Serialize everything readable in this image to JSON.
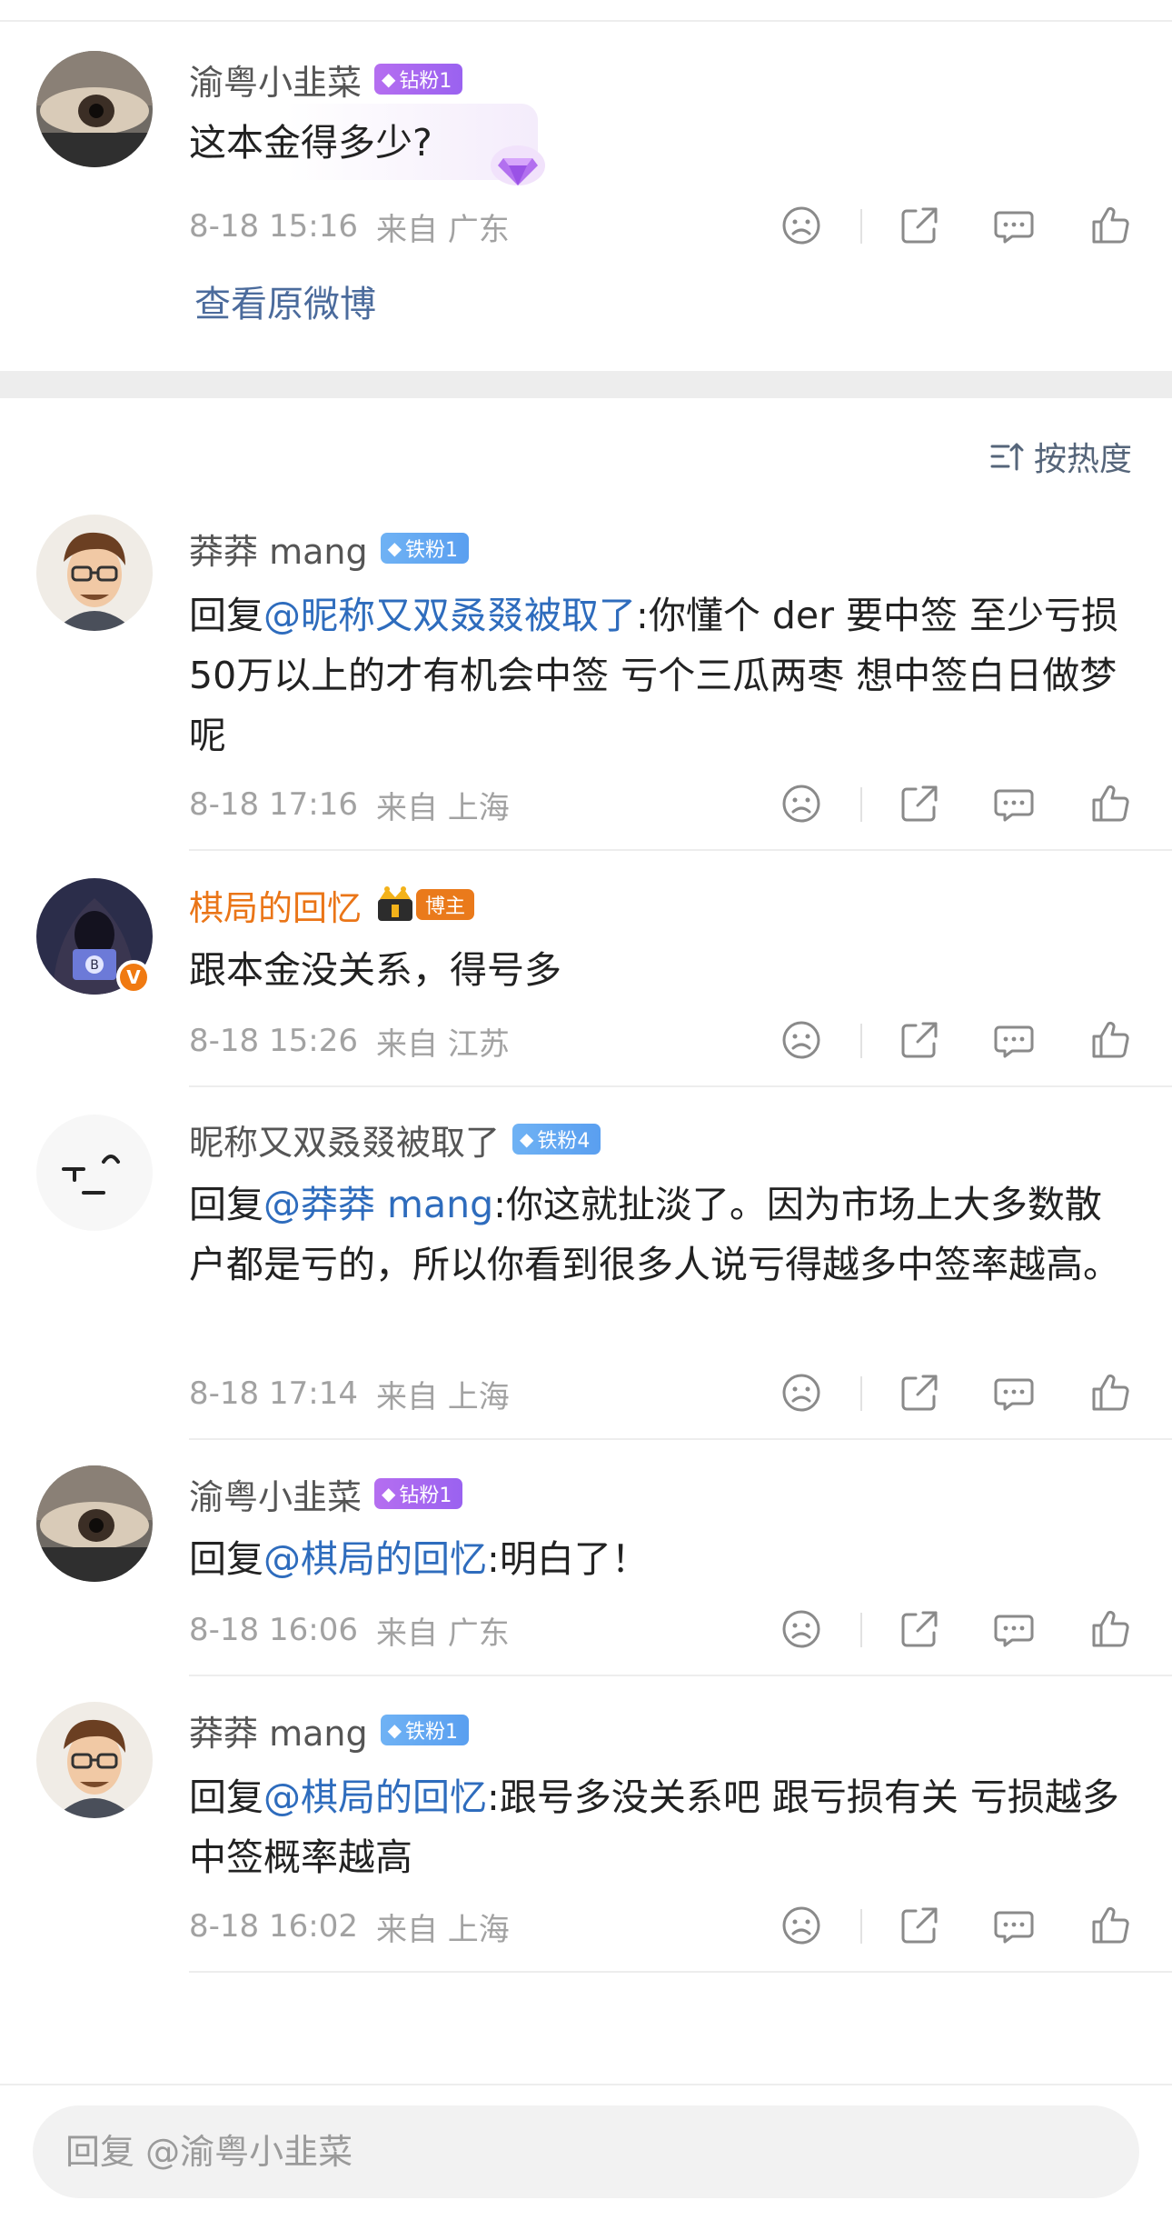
{
  "root_comment": {
    "user": "渝粤小韭菜",
    "badge": "钻粉1",
    "text": "这本金得多少?",
    "time": "8-18 15:16",
    "location": "来自 广东",
    "view_original": "查看原微博"
  },
  "sort_label": "按热度",
  "replies": [
    {
      "user": "莽莽 mang",
      "badge": "铁粉1",
      "prefix": "回复",
      "mention": "@昵称又双叒叕被取了",
      "text": ":你懂个 der 要中签 至少亏损50万以上的才有机会中签 亏个三瓜两枣 想中签白日做梦呢",
      "time": "8-18 17:16",
      "location": "来自 上海"
    },
    {
      "user": "棋局的回忆",
      "badge": "博主",
      "prefix": "",
      "mention": "",
      "text": "跟本金没关系，得号多",
      "time": "8-18 15:26",
      "location": "来自 江苏"
    },
    {
      "user": "昵称又双叒叕被取了",
      "badge": "铁粉4",
      "prefix": "回复",
      "mention": "@莽莽 mang",
      "text": ":你这就扯淡了。因为市场上大多数散户都是亏的，所以你看到很多人说亏得越多中签率越高。",
      "time": "8-18 17:14",
      "location": "来自 上海"
    },
    {
      "user": "渝粤小韭菜",
      "badge": "钻粉1",
      "prefix": "回复",
      "mention": "@棋局的回忆",
      "text": ":明白了！",
      "time": "8-18 16:06",
      "location": "来自 广东"
    },
    {
      "user": "莽莽 mang",
      "badge": "铁粉1",
      "prefix": "回复",
      "mention": "@棋局的回忆",
      "text": ":跟号多没关系吧  跟亏损有关 亏损越多 中签概率越高",
      "time": "8-18 16:02",
      "location": "来自 上海"
    }
  ],
  "reply_input": {
    "placeholder": "回复 @渝粤小韭菜"
  },
  "icons": {
    "dislike": "frown-face-icon",
    "share": "share-icon",
    "comment": "comment-bubble-icon",
    "like": "thumbs-up-icon",
    "sort": "sort-icon"
  },
  "colors": {
    "mention": "#2e6cbd",
    "blogger_name": "#ea7517",
    "diamond_badge": "#a868f0",
    "iron_badge": "#63a8f2",
    "host_badge": "#ea7a1b"
  }
}
